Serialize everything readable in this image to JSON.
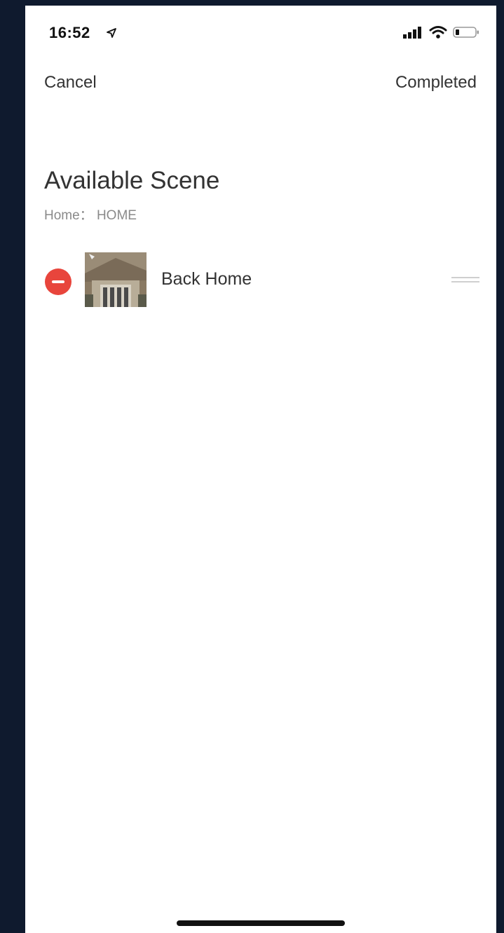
{
  "status_bar": {
    "time": "16:52",
    "icons": [
      "location-arrow-icon",
      "signal-icon",
      "wifi-icon",
      "battery-icon"
    ]
  },
  "nav": {
    "cancel_label": "Cancel",
    "completed_label": "Completed"
  },
  "section": {
    "title": "Available Scene",
    "subtitle": "Home： HOME"
  },
  "scenes": [
    {
      "name": "Back Home",
      "thumbnail_icon": "house-photo-thumbnail"
    }
  ],
  "colors": {
    "remove_red": "#e8453c",
    "background_dark": "#0f1a2e",
    "text_primary": "#333333",
    "text_secondary": "#8a8a8a"
  }
}
